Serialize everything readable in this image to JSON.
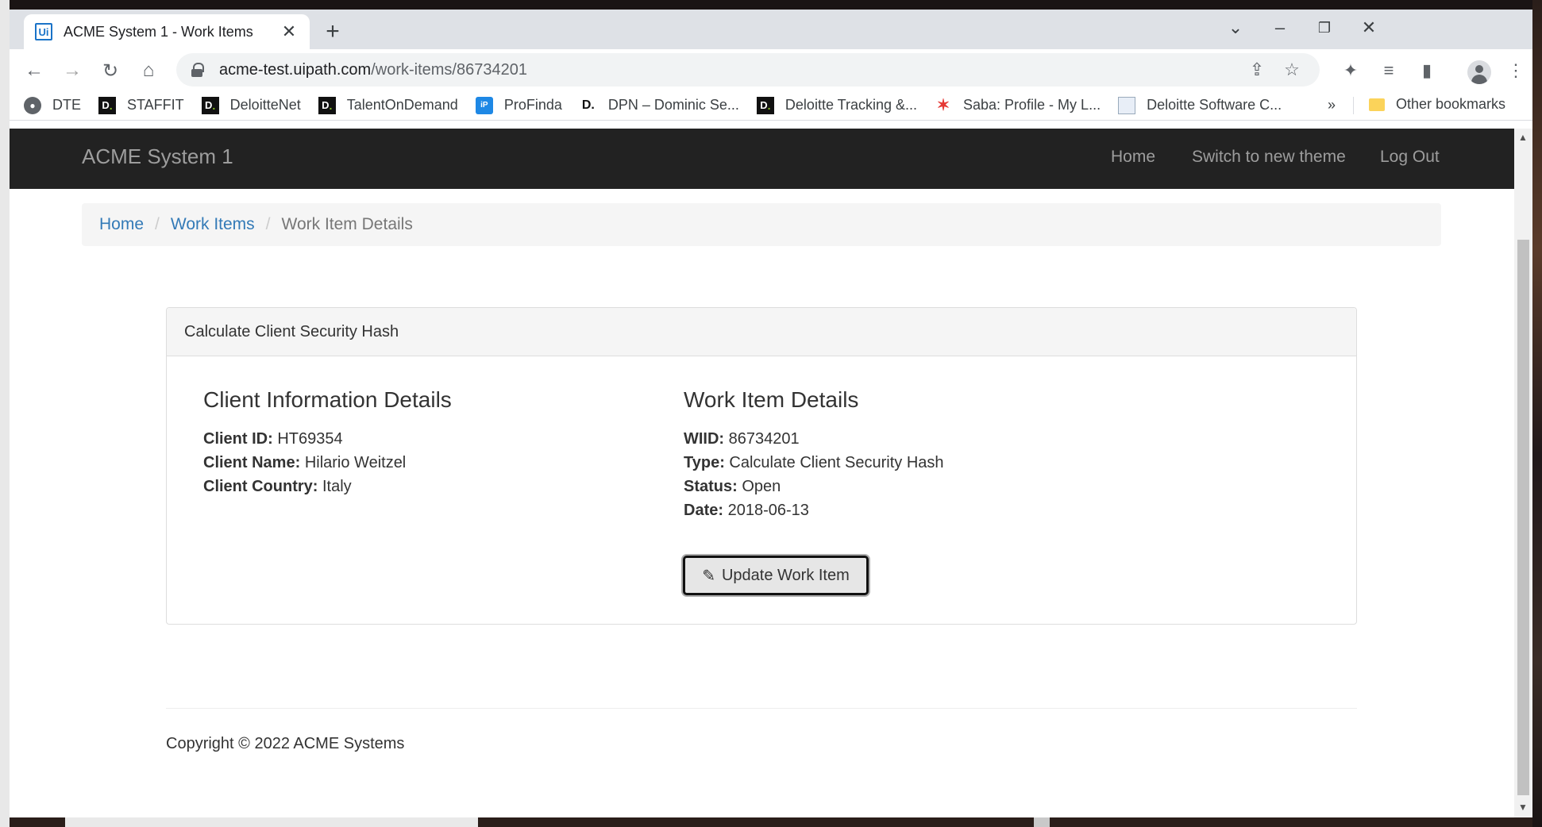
{
  "browser": {
    "tab_title": "ACME System 1 - Work Items",
    "tab_favicon": "Ui",
    "url_host": "acme-test.uipath.com",
    "url_path": "/work-items/86734201",
    "new_tab": "+",
    "tab_close": "✕"
  },
  "bookmarks": {
    "items": [
      {
        "label": "DTE",
        "icon": "globe-icon"
      },
      {
        "label": "STAFFIT",
        "icon": "deloitte-icon"
      },
      {
        "label": "DeloitteNet",
        "icon": "deloitte-icon"
      },
      {
        "label": "TalentOnDemand",
        "icon": "deloitte-icon"
      },
      {
        "label": "ProFinda",
        "icon": "profinda-icon"
      },
      {
        "label": "DPN – Dominic Se...",
        "icon": "dpn-icon"
      },
      {
        "label": "Deloitte Tracking &...",
        "icon": "deloitte-icon"
      },
      {
        "label": "Saba: Profile - My L...",
        "icon": "saba-icon"
      },
      {
        "label": "Deloitte Software C...",
        "icon": "document-icon"
      }
    ],
    "more": "»",
    "other": "Other bookmarks"
  },
  "navbar": {
    "brand": "ACME System 1",
    "links": [
      "Home",
      "Switch to new theme",
      "Log Out"
    ]
  },
  "breadcrumb": {
    "home": "Home",
    "work_items": "Work Items",
    "current": "Work Item Details",
    "separator": "/"
  },
  "panel": {
    "heading": "Calculate Client Security Hash",
    "client": {
      "title": "Client Information Details",
      "fields": [
        {
          "label": "Client ID:",
          "value": "HT69354"
        },
        {
          "label": "Client Name:",
          "value": "Hilario Weitzel"
        },
        {
          "label": "Client Country:",
          "value": "Italy"
        }
      ]
    },
    "work_item": {
      "title": "Work Item Details",
      "fields": [
        {
          "label": "WIID:",
          "value": "86734201"
        },
        {
          "label": "Type:",
          "value": "Calculate Client Security Hash"
        },
        {
          "label": "Status:",
          "value": "Open"
        },
        {
          "label": "Date:",
          "value": "2018-06-13"
        }
      ]
    },
    "update_button": "Update Work Item"
  },
  "footer": {
    "copyright": "Copyright © 2022 ACME Systems"
  }
}
